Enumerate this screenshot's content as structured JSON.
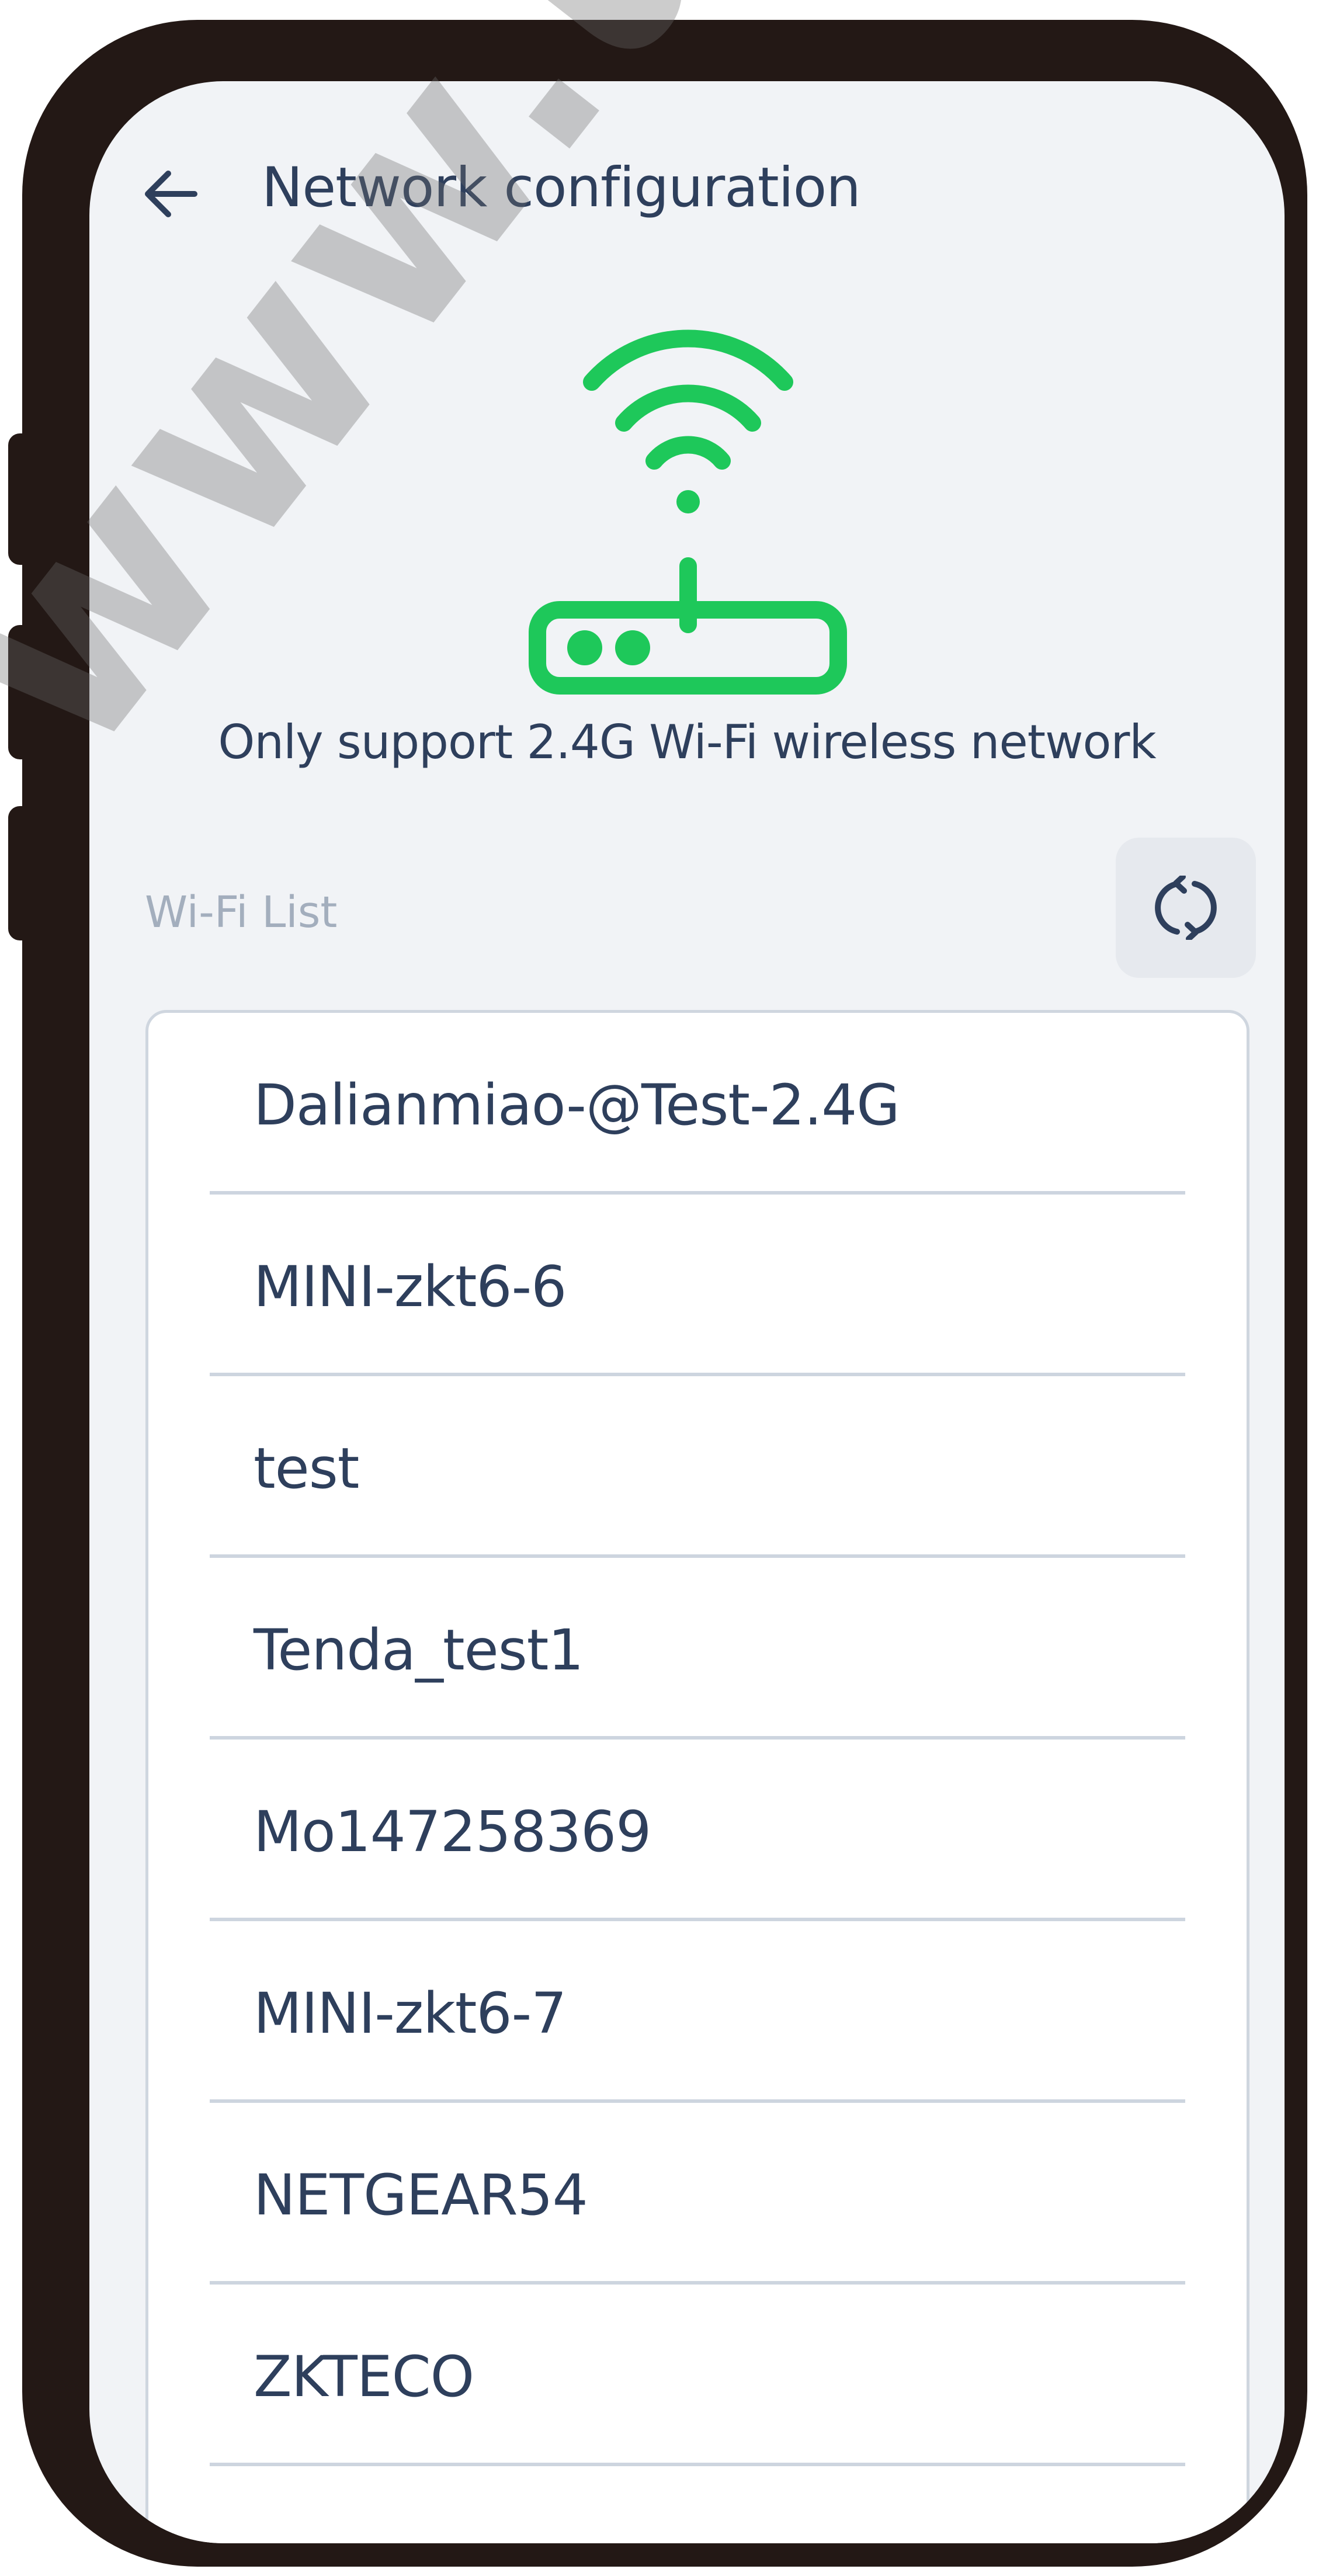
{
  "header": {
    "back_icon": "arrow-left-icon",
    "title": "Network configuration"
  },
  "illustration": {
    "icon": "wifi-router-icon",
    "color": "#1ec85a"
  },
  "support_note": "Only support 2.4G Wi-Fi wireless network",
  "wifi_list": {
    "label": "Wi-Fi List",
    "refresh_icon": "refresh-icon",
    "networks": [
      "Dalianmiao-@Test-2.4G",
      "MINI-zkt6-6",
      "test",
      "Tenda_test1",
      "Mo147258369",
      "MINI-zkt6-7",
      "NETGEAR54",
      "ZKTECO"
    ]
  },
  "watermark": "www.us-plast.",
  "colors": {
    "accent": "#1ec85a",
    "text": "#2e3f5c",
    "muted_text": "#a3aebd",
    "screen_background": "#f1f3f6",
    "frame": "#231815"
  }
}
